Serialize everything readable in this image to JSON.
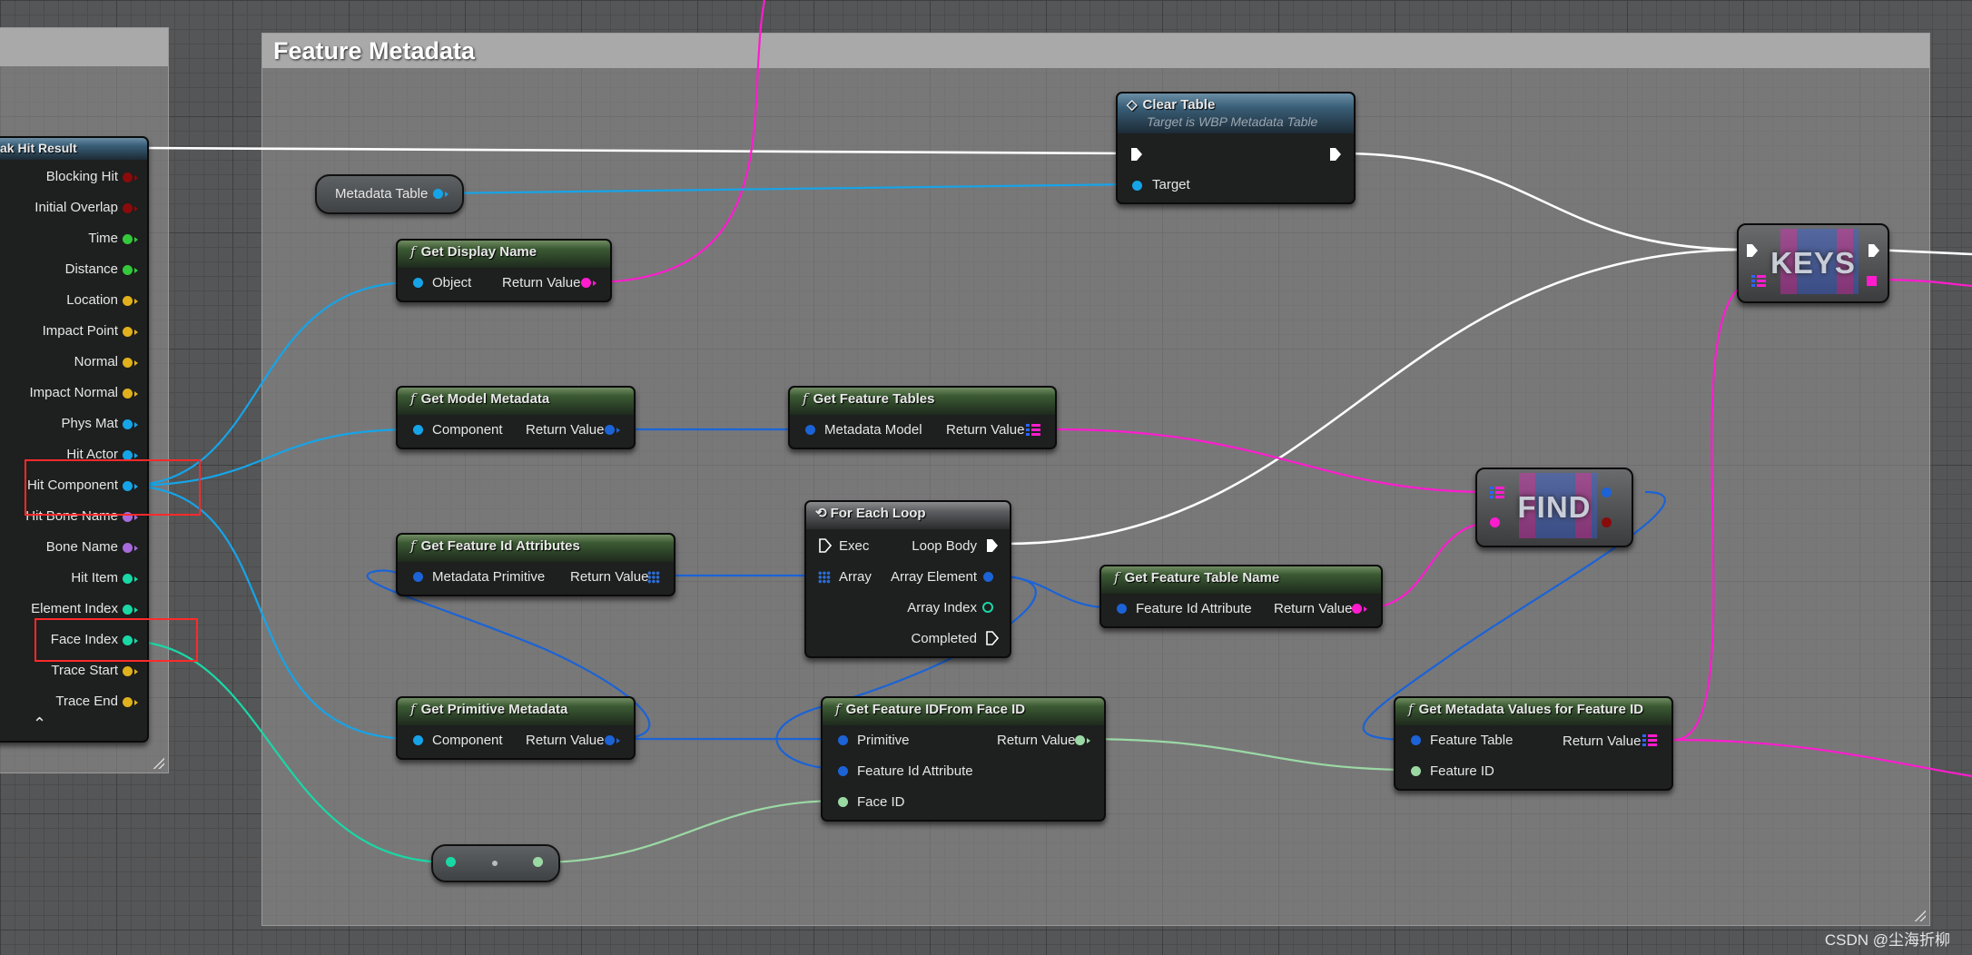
{
  "comment": {
    "title": "Feature  Metadata"
  },
  "break_hit_result": {
    "title": "ak Hit Result",
    "collapse_glyph": "⌃",
    "pins": [
      {
        "label": "Blocking Hit",
        "color": "#8a0b0b"
      },
      {
        "label": "Initial Overlap",
        "color": "#8a0b0b"
      },
      {
        "label": "Time",
        "color": "#33c93b"
      },
      {
        "label": "Distance",
        "color": "#33c93b"
      },
      {
        "label": "Location",
        "color": "#e0b01d"
      },
      {
        "label": "Impact Point",
        "color": "#e0b01d"
      },
      {
        "label": "Normal",
        "color": "#e0b01d"
      },
      {
        "label": "Impact Normal",
        "color": "#e0b01d"
      },
      {
        "label": "Phys Mat",
        "color": "#16a4e8"
      },
      {
        "label": "Hit Actor",
        "color": "#16a4e8"
      },
      {
        "label": "Hit Component",
        "color": "#16a4e8"
      },
      {
        "label": "Hit Bone Name",
        "color": "#a86bdc"
      },
      {
        "label": "Bone Name",
        "color": "#a86bdc"
      },
      {
        "label": "Hit Item",
        "color": "#19d8a6"
      },
      {
        "label": "Element Index",
        "color": "#19d8a6"
      },
      {
        "label": "Face Index",
        "color": "#19d8a6"
      },
      {
        "label": "Trace Start",
        "color": "#e0b01d"
      },
      {
        "label": "Trace End",
        "color": "#e0b01d"
      }
    ]
  },
  "metadata_table_var": {
    "label": "Metadata Table"
  },
  "clear_table": {
    "title": "Clear Table",
    "subtitle": "Target is WBP Metadata Table",
    "target_label": "Target"
  },
  "get_display_name": {
    "title": "Get Display Name",
    "in_label": "Object",
    "out_label": "Return Value"
  },
  "get_model_metadata": {
    "title": "Get Model Metadata",
    "in_label": "Component",
    "out_label": "Return Value"
  },
  "get_feature_tables": {
    "title": "Get Feature Tables",
    "in_label": "Metadata Model",
    "out_label": "Return Value"
  },
  "get_feature_id_attributes": {
    "title": "Get Feature Id Attributes",
    "in_label": "Metadata Primitive",
    "out_label": "Return Value"
  },
  "for_each_loop": {
    "title": "For Each Loop",
    "exec_label": "Exec",
    "array_label": "Array",
    "loop_body_label": "Loop Body",
    "array_element_label": "Array Element",
    "array_index_label": "Array Index",
    "completed_label": "Completed"
  },
  "get_feature_table_name": {
    "title": "Get Feature Table Name",
    "in_label": "Feature Id Attribute",
    "out_label": "Return Value"
  },
  "get_primitive_metadata": {
    "title": "Get Primitive Metadata",
    "in_label": "Component",
    "out_label": "Return Value"
  },
  "get_feature_id_from_face_id": {
    "title": "Get Feature IDFrom Face ID",
    "primitive_label": "Primitive",
    "attr_label": "Feature Id Attribute",
    "face_label": "Face ID",
    "out_label": "Return Value"
  },
  "get_metadata_values": {
    "title": "Get Metadata Values for Feature ID",
    "table_label": "Feature Table",
    "id_label": "Feature ID",
    "out_label": "Return Value"
  },
  "keys_node": {
    "label": "KEYS"
  },
  "find_node": {
    "label": "FIND"
  },
  "watermark": "CSDN @尘海折柳",
  "colors": {
    "object": "#16a4e8",
    "string": "#ff1ccf",
    "int": "#19d8a6",
    "struct": "#1b63d6",
    "exec": "#ffffff",
    "float": "#33c93b",
    "feature_id_int": "#9bd9a4"
  }
}
